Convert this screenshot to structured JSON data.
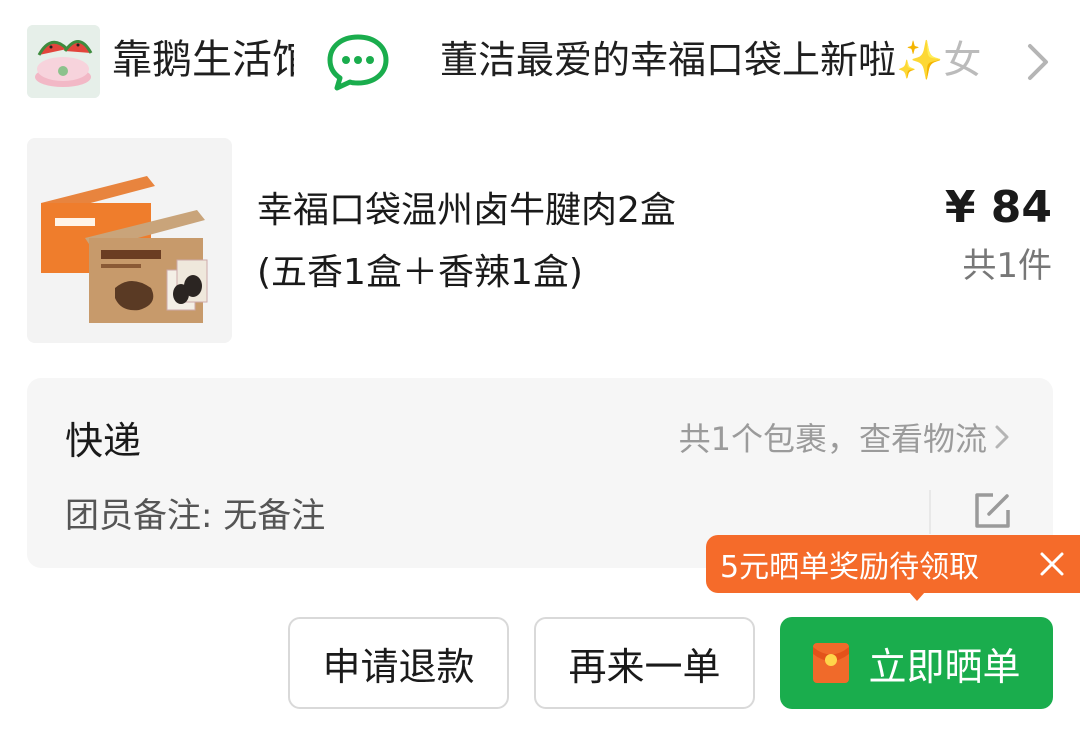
{
  "header": {
    "shop_name": "靠鹅生活馆",
    "promo_text": "董洁最爱的幸福口袋上新啦",
    "promo_sparkle": "✨",
    "promo_tail": "女",
    "icons": {
      "chat": "chat-bubble-icon",
      "chevron": "chevron-right-icon"
    }
  },
  "product": {
    "title_line1": "幸福口袋温州卤牛腱肉2盒",
    "title_line2": "(五香1盒＋香辣1盒)",
    "price": "¥ 84",
    "quantity": "共1件"
  },
  "delivery": {
    "label": "快递",
    "logistics_link": "共1个包裹，查看物流",
    "remark": "团员备注: 无备注",
    "icons": {
      "edit": "edit-icon",
      "chevron": "chevron-right-icon"
    }
  },
  "reward_tip": {
    "text": "5元晒单奖励待领取",
    "close_icon": "close-icon"
  },
  "actions": {
    "refund": "申请退款",
    "reorder": "再来一单",
    "share": "立即晒单"
  },
  "colors": {
    "primary_green": "#1aad4d",
    "tip_orange": "#f56b2a",
    "card_bg": "#f6f6f6",
    "muted_text": "#9b9b9b"
  }
}
